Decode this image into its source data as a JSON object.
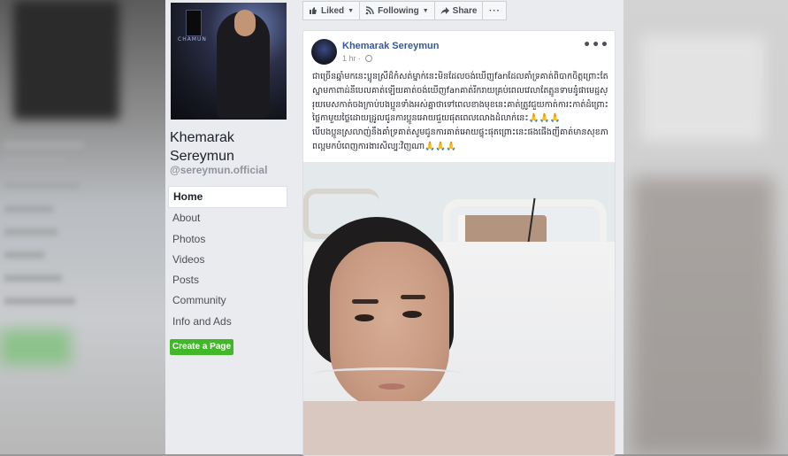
{
  "page": {
    "name": "Khemarak Sereymun",
    "handle": "@sereymun.official"
  },
  "cover": {
    "brand_text": "CHAMUN"
  },
  "nav": {
    "items": [
      {
        "label": "Home",
        "active": true
      },
      {
        "label": "About",
        "active": false
      },
      {
        "label": "Photos",
        "active": false
      },
      {
        "label": "Videos",
        "active": false
      },
      {
        "label": "Posts",
        "active": false
      },
      {
        "label": "Community",
        "active": false
      },
      {
        "label": "Info and Ads",
        "active": false
      }
    ],
    "create_page_label": "Create a Page"
  },
  "actions": {
    "liked_label": "Liked",
    "following_label": "Following",
    "share_label": "Share",
    "more_label": "···"
  },
  "post": {
    "author": "Khemarak Sereymun",
    "time": "1 hr",
    "more_label": "•••",
    "text": "ជាច្រើនឆ្នាំមកនេះប្អូនស្រីដ៏កំសត់ម្នាក់នេះមិនដែលចង់ឃើញfanដែលគាំទ្រគាត់ពិបាកចិត្តព្រោះតែស្នាមកាពាដ់នីបេលគាត់ឡើយគាត់ចង់ឃើញfanគាត់រីករាយគ្រប់ពេលវេលាតែត្អូនទាមនូំផាមេដ្ជស្រុយមេសកាត់ចងក្រាប់បងប្អូនទាំងអស់គ្នាថាទៅពេលខាងមុខនេះគាត់ត្រូវជួយកាត់ការះកាត់ដំព្រោះថ្លៃកាមួយថ្លៃដោយដ្រូលជូនការប្អូនអោយជួយផុតពេលលោងដំលាក់នេះ",
    "text2": "បើបងប្អូនស្រលាញ់នឹងគាំទ្រគាត់សូមជូនការគាត់អោយផ្ទុះផុតព្រោះនេះផងផើងញីគាត់មានសុខភាពល្អមកបំពេញការងារសិល្បៈវិញណា",
    "emoji": "🙏🙏🙏"
  }
}
